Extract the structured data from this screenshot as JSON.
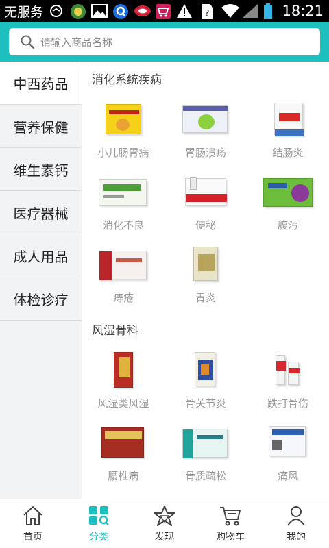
{
  "status_bar": {
    "carrier": "无服务",
    "time": "18:21",
    "icons": [
      "sync-icon",
      "app-icon",
      "image-icon",
      "q-app-icon",
      "alarm-icon",
      "shopping-icon",
      "warning-icon",
      "sim-icon",
      "wifi-icon",
      "signal-icon",
      "battery-icon"
    ]
  },
  "search": {
    "placeholder": "请输入商品名称"
  },
  "sidebar": {
    "items": [
      {
        "label": "中西药品",
        "active": true
      },
      {
        "label": "营养保健"
      },
      {
        "label": "维生素钙"
      },
      {
        "label": "医疗器械"
      },
      {
        "label": "成人用品"
      },
      {
        "label": "体检诊疗"
      }
    ]
  },
  "sections": [
    {
      "title": "消化系统疾病",
      "items": [
        {
          "label": "小儿肠胃病"
        },
        {
          "label": "胃肠溃疡"
        },
        {
          "label": "结肠炎"
        },
        {
          "label": "消化不良"
        },
        {
          "label": "便秘"
        },
        {
          "label": "腹泻"
        },
        {
          "label": "痔疮"
        },
        {
          "label": "胃炎"
        }
      ]
    },
    {
      "title": "风湿骨科",
      "items": [
        {
          "label": "风湿类风湿"
        },
        {
          "label": "骨关节炎"
        },
        {
          "label": "跌打骨伤"
        },
        {
          "label": "腰椎病"
        },
        {
          "label": "骨质疏松"
        },
        {
          "label": "痛风"
        }
      ]
    }
  ],
  "bottom_nav": {
    "items": [
      {
        "label": "首页",
        "icon": "home-icon"
      },
      {
        "label": "分类",
        "icon": "category-icon",
        "active": true
      },
      {
        "label": "发现",
        "icon": "discover-icon"
      },
      {
        "label": "购物车",
        "icon": "cart-icon"
      },
      {
        "label": "我的",
        "icon": "profile-icon"
      }
    ]
  },
  "colors": {
    "accent": "#1ec0bf",
    "sidebar_bg": "#f2f3f5",
    "label_gray": "#999999"
  }
}
